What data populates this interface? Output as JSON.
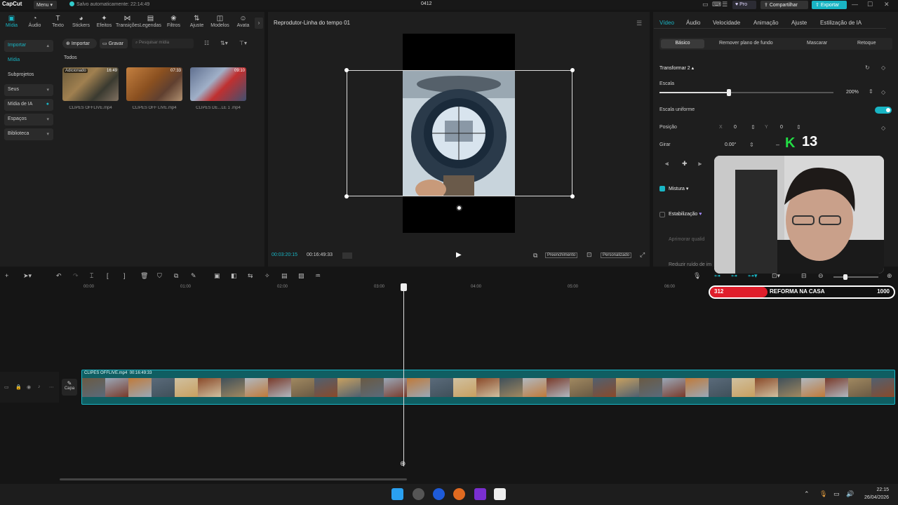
{
  "app": {
    "logo": "CapCut",
    "menu": "Menu",
    "autosave": "Salvo automaticamente: 22:14:49",
    "project_name": "0412",
    "pro": "Pro",
    "share": "Compartilhar",
    "export": "Exportar"
  },
  "toolbar_tabs": [
    {
      "label": "Mídia",
      "icon": "media-icon",
      "glyph": "▣"
    },
    {
      "label": "Áudio",
      "icon": "audio-icon",
      "glyph": "◔"
    },
    {
      "label": "Texto",
      "icon": "text-icon",
      "glyph": "T"
    },
    {
      "label": "Stickers",
      "icon": "sticker-icon",
      "glyph": "◕"
    },
    {
      "label": "Efeitos",
      "icon": "effects-icon",
      "glyph": "✦"
    },
    {
      "label": "Transições",
      "icon": "transition-icon",
      "glyph": "⋈"
    },
    {
      "label": "Legendas",
      "icon": "captions-icon",
      "glyph": "▤"
    },
    {
      "label": "Filtros",
      "icon": "filters-icon",
      "glyph": "❀"
    },
    {
      "label": "Ajuste",
      "icon": "adjust-icon",
      "glyph": "⇅"
    },
    {
      "label": "Modelos",
      "icon": "templates-icon",
      "glyph": "◫"
    },
    {
      "label": "Avata",
      "icon": "avatar-icon",
      "glyph": "☺"
    }
  ],
  "sidebar": {
    "items": [
      {
        "label": "Importar",
        "head": true,
        "active": true
      },
      {
        "label": "Mídia",
        "head": false,
        "active": true
      },
      {
        "label": "Subprojetos",
        "head": false,
        "active": false
      },
      {
        "label": "Seus",
        "head": true,
        "active": false
      },
      {
        "label": "Mídia de IA",
        "head": true,
        "active": false
      },
      {
        "label": "Espaços",
        "head": true,
        "active": false
      },
      {
        "label": "Biblioteca",
        "head": true,
        "active": false
      }
    ]
  },
  "media": {
    "import_label": "Importar",
    "record_label": "Gravar",
    "search_placeholder": "Pesquisar mídia",
    "filter_all": "Todos",
    "items": [
      {
        "name": "CLIPES OFFLIVE.mp4",
        "badge": "Adicionado",
        "duration": "16:49"
      },
      {
        "name": "CLIPES OFF LIVE.mp4",
        "badge": "",
        "duration": "07:33"
      },
      {
        "name": "CLIPES DE...LE 1 .mp4",
        "badge": "",
        "duration": "09:10"
      }
    ]
  },
  "player": {
    "title": "Reprodutor-Linha do tempo 01",
    "current_time": "00:03:20:15",
    "total_time": "00:16:49:33",
    "fill_label": "Preenchimento",
    "custom_label": "Personalizado"
  },
  "properties": {
    "tabs": [
      "Vídeo",
      "Áudio",
      "Velocidade",
      "Animação",
      "Ajuste",
      "Estilização de IA"
    ],
    "subtabs": [
      "Básico",
      "Remover plano de fundo",
      "Mascarar",
      "Retoque"
    ],
    "transform_label": "Transformar 2",
    "scale_label": "Escala",
    "scale_value": "200%",
    "scale_level": 0.4,
    "uniform_label": "Escala uniforme",
    "position_label": "Posição",
    "x_label": "X",
    "x_value": "0",
    "y_label": "Y",
    "y_value": "0",
    "rotate_label": "Girar",
    "rotate_value": "0.00°",
    "blend_label": "Mistura",
    "stabilize_label": "Estabilização",
    "enhance_label": "Aprimorar qualid",
    "noise_label": "Reduzir ruído de im"
  },
  "overlay": {
    "counter_value": "13",
    "goal_current": "312",
    "goal_text": "REFORMA NA CASA",
    "goal_max": "1000",
    "goal_fraction": 0.312
  },
  "timeline": {
    "ruler": [
      "00:00",
      "01:00",
      "02:00",
      "03:00",
      "04:00",
      "05:00",
      "06:00"
    ],
    "clip_name": "CLIPES OFFLIVE.mp4",
    "clip_duration": "00:16:49:33",
    "cover_label": "Capa"
  },
  "taskbar": {
    "time": "22:15",
    "date": "26/04/2026"
  },
  "colors": {
    "accent": "#19b5c4",
    "goal_red": "#e01e2b",
    "counter_green": "#22dd44"
  }
}
